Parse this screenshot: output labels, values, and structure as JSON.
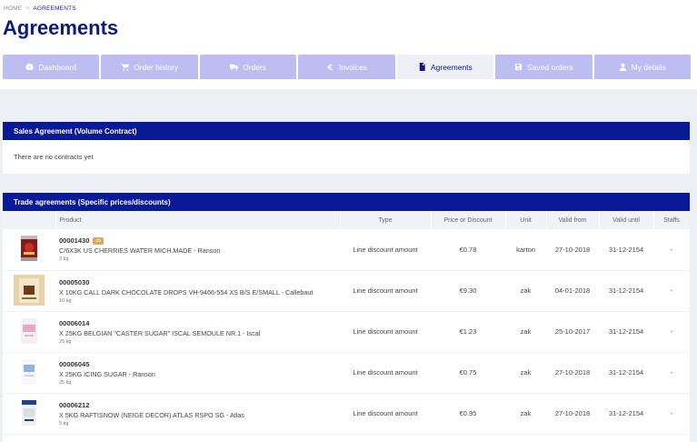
{
  "breadcrumb": {
    "home": "HOME",
    "separator": ">",
    "current": "AGREEMENTS"
  },
  "page_title": "Agreements",
  "tabs": [
    {
      "label": "Dashboard",
      "icon": "dashboard-icon",
      "active": false
    },
    {
      "label": "Order history",
      "icon": "cart-icon",
      "active": false
    },
    {
      "label": "Orders",
      "icon": "truck-icon",
      "active": false
    },
    {
      "label": "Invoices",
      "icon": "euro-icon",
      "active": false
    },
    {
      "label": "Agreements",
      "icon": "document-icon",
      "active": true
    },
    {
      "label": "Saved orders",
      "icon": "save-icon",
      "active": false
    },
    {
      "label": "My details",
      "icon": "user-icon",
      "active": false
    }
  ],
  "sales_agreement": {
    "title": "Sales Agreement (Volume Contract)",
    "empty_text": "There are no contracts yet"
  },
  "trade_agreements": {
    "title": "Trade agreements (Specific prices/discounts)",
    "columns": [
      "Product",
      "Type",
      "Price or Discount",
      "Unit",
      "Valid from",
      "Valid until",
      "Staffs"
    ],
    "rows": [
      {
        "code": "00001430",
        "badge": "cb",
        "description": "C/6X3K US CHERRIES WATER MICH.MADE - Ranson",
        "weight": "3 kg",
        "type": "Line discount amount",
        "price": "€0.78",
        "unit": "karton",
        "valid_from": "27-10-2018",
        "valid_until": "31-12-2154",
        "staffs": "-",
        "image": "cherries-can-image"
      },
      {
        "code": "00005030",
        "badge": "",
        "description": "X 10KG CALL DARK CHOCOLATE DROPS VH-9466-554 XS B/S E/SMALL - Callebaut",
        "weight": "10 kg",
        "type": "Line discount amount",
        "price": "€9.30",
        "unit": "zak",
        "valid_from": "04-01-2018",
        "valid_until": "31-12-2154",
        "staffs": "-",
        "image": "chocolate-bag-image"
      },
      {
        "code": "00006014",
        "badge": "",
        "description": "X 25KG BELGIAN \"CASTER SUGAR\" ISCAL SEMOULE NR.1 - Iscal",
        "weight": "25 kg",
        "type": "Line discount amount",
        "price": "€1.23",
        "unit": "zak",
        "valid_from": "25-10-2017",
        "valid_until": "31-12-2154",
        "staffs": "-",
        "image": "sugar-bag-image"
      },
      {
        "code": "00006045",
        "badge": "",
        "description": "X 25KG ICING SUGAR - Ranson",
        "weight": "25 kg",
        "type": "Line discount amount",
        "price": "€0.75",
        "unit": "zak",
        "valid_from": "27-10-2018",
        "valid_until": "31-12-2154",
        "staffs": "-",
        "image": "icing-sugar-bag-image"
      },
      {
        "code": "00006212",
        "badge": "",
        "description": "X 5KG RAFTISNOW (NEIGE DECOR) ATLAS RSPO SG - Atlas",
        "weight": "5 kg",
        "type": "Line discount amount",
        "price": "€0.95",
        "unit": "zak",
        "valid_from": "27-10-2018",
        "valid_until": "31-12-2154",
        "staffs": "-",
        "image": "raftisnow-bag-image"
      }
    ]
  },
  "colors": {
    "primary": "#0a1a96",
    "tab_inactive": "#bcbdf0",
    "tab_active": "#eef0f5",
    "title": "#0d1a7a",
    "badge": "#d8a85b"
  }
}
